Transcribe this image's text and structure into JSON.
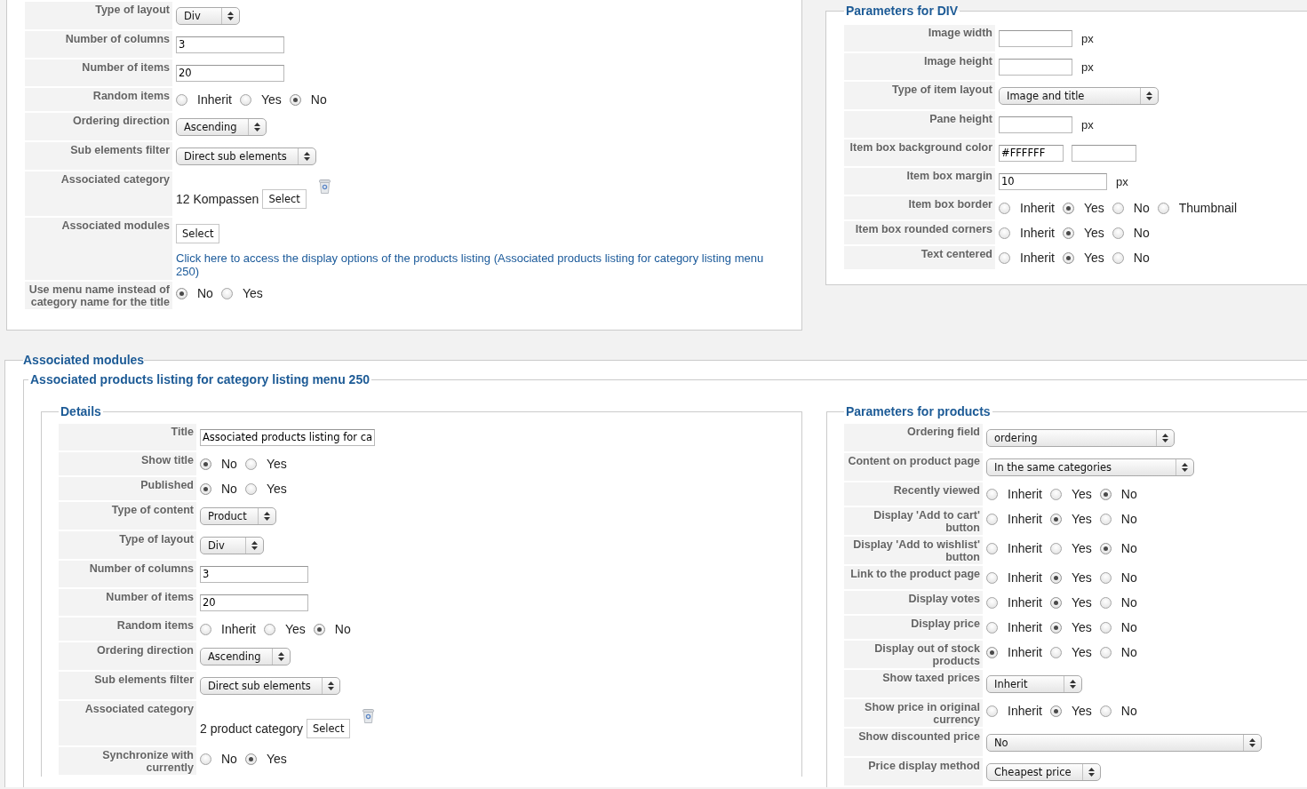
{
  "settings_panel": {
    "rows": [
      {
        "label": "Type of layout",
        "kind": "select",
        "value": "Div"
      },
      {
        "label": "Number of columns",
        "kind": "text",
        "value": "3"
      },
      {
        "label": "Number of items",
        "kind": "text",
        "value": "20"
      },
      {
        "label": "Random items",
        "kind": "radio",
        "options": [
          {
            "label": "Inherit",
            "selected": false
          },
          {
            "label": "Yes",
            "selected": false
          },
          {
            "label": "No",
            "selected": true
          }
        ]
      },
      {
        "label": "Ordering direction",
        "kind": "select",
        "value": "Ascending"
      },
      {
        "label": "Sub elements filter",
        "kind": "select",
        "value": "Direct sub elements"
      },
      {
        "label": "Associated category",
        "kind": "category",
        "value": "12 Kompassen",
        "button": "Select"
      },
      {
        "label": "Associated modules",
        "kind": "modules",
        "button": "Select",
        "link": "Click here to access the display options of the products listing (Associated products listing for category listing menu 250)"
      },
      {
        "label": "Use menu name instead of category name for the title",
        "kind": "radio",
        "options": [
          {
            "label": "No",
            "selected": true
          },
          {
            "label": "Yes",
            "selected": false
          }
        ]
      }
    ]
  },
  "div_parameters": {
    "title": "Parameters for DIV",
    "rows": [
      {
        "label": "Image width",
        "kind": "text",
        "unit": "px"
      },
      {
        "label": "Image height",
        "kind": "text",
        "unit": "px"
      },
      {
        "label": "Type of item layout",
        "kind": "select",
        "value": "Image and title"
      },
      {
        "label": "Pane height",
        "kind": "text",
        "unit": "px"
      },
      {
        "label": "Item box background color",
        "kind": "color",
        "value": "#FFFFFF"
      },
      {
        "label": "Item box margin",
        "kind": "text",
        "value": "10",
        "unit": "px"
      },
      {
        "label": "Item box border",
        "kind": "radio",
        "options": [
          {
            "label": "Inherit",
            "selected": false
          },
          {
            "label": "Yes",
            "selected": true
          },
          {
            "label": "No",
            "selected": false
          },
          {
            "label": "Thumbnail",
            "selected": false
          }
        ]
      },
      {
        "label": "Item box rounded corners",
        "kind": "radio",
        "options": [
          {
            "label": "Inherit",
            "selected": false
          },
          {
            "label": "Yes",
            "selected": true
          },
          {
            "label": "No",
            "selected": false
          }
        ]
      },
      {
        "label": "Text centered",
        "kind": "radio",
        "options": [
          {
            "label": "Inherit",
            "selected": false
          },
          {
            "label": "Yes",
            "selected": true
          },
          {
            "label": "No",
            "selected": false
          }
        ]
      }
    ]
  },
  "associated_modules": {
    "title": "Associated modules",
    "module": {
      "title": "Associated products listing for category listing menu 250",
      "details": {
        "title": "Details",
        "rows": [
          {
            "label": "Title",
            "kind": "text",
            "value": "Associated products listing for ca"
          },
          {
            "label": "Show title",
            "kind": "radio",
            "options": [
              {
                "label": "No",
                "selected": true
              },
              {
                "label": "Yes",
                "selected": false
              }
            ]
          },
          {
            "label": "Published",
            "kind": "radio",
            "options": [
              {
                "label": "No",
                "selected": true
              },
              {
                "label": "Yes",
                "selected": false
              }
            ]
          },
          {
            "label": "Type of content",
            "kind": "select",
            "value": "Product"
          },
          {
            "label": "Type of layout",
            "kind": "select",
            "value": "Div"
          },
          {
            "label": "Number of columns",
            "kind": "text",
            "value": "3"
          },
          {
            "label": "Number of items",
            "kind": "text",
            "value": "20"
          },
          {
            "label": "Random items",
            "kind": "radio",
            "options": [
              {
                "label": "Inherit",
                "selected": false
              },
              {
                "label": "Yes",
                "selected": false
              },
              {
                "label": "No",
                "selected": true
              }
            ]
          },
          {
            "label": "Ordering direction",
            "kind": "select",
            "value": "Ascending"
          },
          {
            "label": "Sub elements filter",
            "kind": "select",
            "value": "Direct sub elements"
          },
          {
            "label": "Associated category",
            "kind": "category",
            "value": "2 product category",
            "button": "Select"
          },
          {
            "label": "Synchronize with currently",
            "kind": "radio",
            "options": [
              {
                "label": "No",
                "selected": false
              },
              {
                "label": "Yes",
                "selected": true
              }
            ]
          }
        ]
      },
      "product_parameters": {
        "title": "Parameters for products",
        "rows": [
          {
            "label": "Ordering field",
            "kind": "select",
            "value": "ordering"
          },
          {
            "label": "Content on product page",
            "kind": "select",
            "value": "In the same categories"
          },
          {
            "label": "Recently viewed",
            "kind": "radio",
            "options": [
              {
                "label": "Inherit",
                "selected": false
              },
              {
                "label": "Yes",
                "selected": false
              },
              {
                "label": "No",
                "selected": true
              }
            ]
          },
          {
            "label": "Display 'Add to cart' button",
            "kind": "radio",
            "options": [
              {
                "label": "Inherit",
                "selected": false
              },
              {
                "label": "Yes",
                "selected": true
              },
              {
                "label": "No",
                "selected": false
              }
            ]
          },
          {
            "label": "Display 'Add to wishlist' button",
            "kind": "radio",
            "options": [
              {
                "label": "Inherit",
                "selected": false
              },
              {
                "label": "Yes",
                "selected": false
              },
              {
                "label": "No",
                "selected": true
              }
            ]
          },
          {
            "label": "Link to the product page",
            "kind": "radio",
            "options": [
              {
                "label": "Inherit",
                "selected": false
              },
              {
                "label": "Yes",
                "selected": true
              },
              {
                "label": "No",
                "selected": false
              }
            ]
          },
          {
            "label": "Display votes",
            "kind": "radio",
            "options": [
              {
                "label": "Inherit",
                "selected": false
              },
              {
                "label": "Yes",
                "selected": true
              },
              {
                "label": "No",
                "selected": false
              }
            ]
          },
          {
            "label": "Display price",
            "kind": "radio",
            "options": [
              {
                "label": "Inherit",
                "selected": false
              },
              {
                "label": "Yes",
                "selected": true
              },
              {
                "label": "No",
                "selected": false
              }
            ]
          },
          {
            "label": "Display out of stock products",
            "kind": "radio",
            "options": [
              {
                "label": "Inherit",
                "selected": true
              },
              {
                "label": "Yes",
                "selected": false
              },
              {
                "label": "No",
                "selected": false
              }
            ]
          },
          {
            "label": "Show taxed prices",
            "kind": "select",
            "value": "Inherit"
          },
          {
            "label": "Show price in original currency",
            "kind": "radio",
            "options": [
              {
                "label": "Inherit",
                "selected": false
              },
              {
                "label": "Yes",
                "selected": true
              },
              {
                "label": "No",
                "selected": false
              }
            ]
          },
          {
            "label": "Show discounted price",
            "kind": "select",
            "value": "No"
          },
          {
            "label": "Price display method",
            "kind": "select",
            "value": "Cheapest price"
          }
        ]
      }
    }
  }
}
